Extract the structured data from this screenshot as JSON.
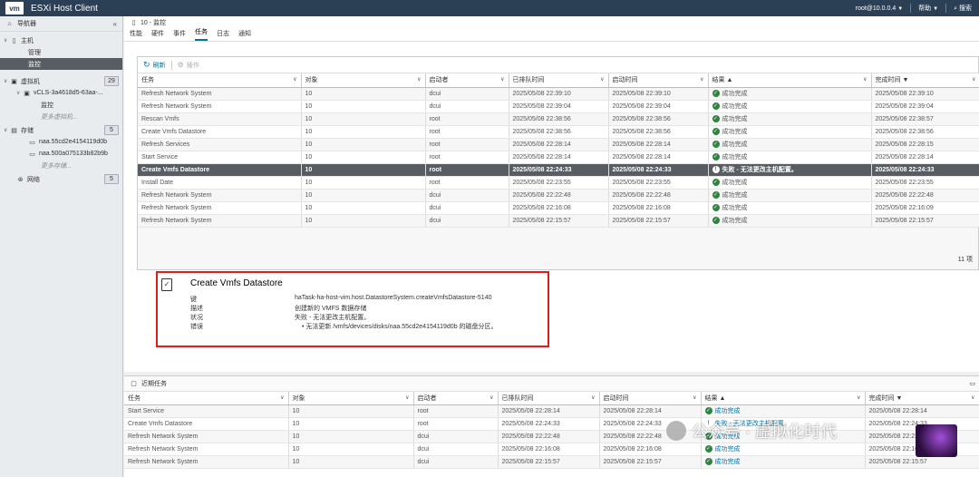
{
  "topbar": {
    "logo": "vm",
    "title": "ESXi Host Client",
    "user": "root@10.0.0.4",
    "help": "帮助",
    "search": "搜索",
    "bg": "#2b3f55"
  },
  "sidebar": {
    "header": "导航器",
    "host": "主机",
    "manage": "管理",
    "monitor": "监控",
    "vms": "虚拟机",
    "vms_count": "29",
    "vm1": "vCLS-3a4618d5-63aa-...",
    "vm1_monitor": "监控",
    "more_vms": "更多虚拟机...",
    "storage": "存储",
    "storage_count": "5",
    "ds1": "naa.55cd2e4154119d0b",
    "ds2": "naa.500a075133b82b9b",
    "more_storage": "更多存储...",
    "network": "网络",
    "network_count": "5"
  },
  "main": {
    "breadcrumb": "10 - 监控",
    "tabs": [
      "性能",
      "硬件",
      "事件",
      "任务",
      "日志",
      "通知"
    ],
    "active_tab": "任务",
    "toolbar": {
      "refresh": "刷新",
      "actions": "操作"
    },
    "columns": [
      "任务",
      "对象",
      "启动者",
      "已排队时间",
      "启动时间",
      "结果 ▲",
      "完成时间 ▼"
    ],
    "rows": [
      {
        "task": "Refresh Network System",
        "obj": "10",
        "by": "dcui",
        "queued": "2025/05/08 22:39:10",
        "started": "2025/05/08 22:39:10",
        "result": "成功完成",
        "done": "2025/05/08 22:39:10"
      },
      {
        "task": "Refresh Network System",
        "obj": "10",
        "by": "dcui",
        "queued": "2025/05/08 22:39:04",
        "started": "2025/05/08 22:39:04",
        "result": "成功完成",
        "done": "2025/05/08 22:39:04"
      },
      {
        "task": "Rescan Vmfs",
        "obj": "10",
        "by": "root",
        "queued": "2025/05/08 22:38:56",
        "started": "2025/05/08 22:38:56",
        "result": "成功完成",
        "done": "2025/05/08 22:38:57"
      },
      {
        "task": "Create Vmfs Datastore",
        "obj": "10",
        "by": "root",
        "queued": "2025/05/08 22:38:56",
        "started": "2025/05/08 22:38:56",
        "result": "成功完成",
        "done": "2025/05/08 22:38:56"
      },
      {
        "task": "Refresh Services",
        "obj": "10",
        "by": "root",
        "queued": "2025/05/08 22:28:14",
        "started": "2025/05/08 22:28:14",
        "result": "成功完成",
        "done": "2025/05/08 22:28:15"
      },
      {
        "task": "Start Service",
        "obj": "10",
        "by": "root",
        "queued": "2025/05/08 22:28:14",
        "started": "2025/05/08 22:28:14",
        "result": "成功完成",
        "done": "2025/05/08 22:28:14"
      },
      {
        "task": "Create Vmfs Datastore",
        "obj": "10",
        "by": "root",
        "queued": "2025/05/08 22:24:33",
        "started": "2025/05/08 22:24:33",
        "result": "失败 - 无法更改主机配置。",
        "done": "2025/05/08 22:24:33"
      },
      {
        "task": "Install Date",
        "obj": "10",
        "by": "root",
        "queued": "2025/05/08 22:23:55",
        "started": "2025/05/08 22:23:55",
        "result": "成功完成",
        "done": "2025/05/08 22:23:55"
      },
      {
        "task": "Refresh Network System",
        "obj": "10",
        "by": "dcui",
        "queued": "2025/05/08 22:22:48",
        "started": "2025/05/08 22:22:48",
        "result": "成功完成",
        "done": "2025/05/08 22:22:48"
      },
      {
        "task": "Refresh Network System",
        "obj": "10",
        "by": "dcui",
        "queued": "2025/05/08 22:16:08",
        "started": "2025/05/08 22:16:08",
        "result": "成功完成",
        "done": "2025/05/08 22:16:09"
      },
      {
        "task": "Refresh Network System",
        "obj": "10",
        "by": "dcui",
        "queued": "2025/05/08 22:15:57",
        "started": "2025/05/08 22:15:57",
        "result": "成功完成",
        "done": "2025/05/08 22:15:57"
      }
    ],
    "count": "11 项"
  },
  "detail": {
    "title": "Create Vmfs Datastore",
    "rows": [
      {
        "key": "键",
        "val": "haTask-ha-host-vim.host.DatastoreSystem.createVmfsDatastore-5140"
      },
      {
        "key": "描述",
        "val": "创建新的 VMFS 数据存储"
      },
      {
        "key": "状况",
        "val": "失败 - 无法更改主机配置。"
      },
      {
        "key": "错误",
        "val": ""
      }
    ],
    "error_bullet": "无法更新 /vmfs/devices/disks/naa.55cd2e4154119d0b 的磁盘分区。",
    "border_color": "#e01c1c"
  },
  "recent": {
    "title": "近期任务",
    "columns": [
      "任务",
      "对象",
      "启动者",
      "已排队时间",
      "启动时间",
      "结果 ▲",
      "完成时间 ▼"
    ],
    "rows": [
      {
        "task": "Start Service",
        "obj": "10",
        "by": "root",
        "queued": "2025/05/08 22:28:14",
        "started": "2025/05/08 22:28:14",
        "result": "成功完成",
        "done": "2025/05/08 22:28:14"
      },
      {
        "task": "Create Vmfs Datastore",
        "obj": "10",
        "by": "root",
        "queued": "2025/05/08 22:24:33",
        "started": "2025/05/08 22:24:33",
        "result": "失败 - 无法更改主机配置。",
        "done": "2025/05/08 22:24:33"
      },
      {
        "task": "Refresh Network System",
        "obj": "10",
        "by": "dcui",
        "queued": "2025/05/08 22:22:48",
        "started": "2025/05/08 22:22:48",
        "result": "成功完成",
        "done": "2025/05/08 22:22:48"
      },
      {
        "task": "Refresh Network System",
        "obj": "10",
        "by": "dcui",
        "queued": "2025/05/08 22:16:08",
        "started": "2025/05/08 22:16:08",
        "result": "成功完成",
        "done": "2025/05/08 22:16:09"
      },
      {
        "task": "Refresh Network System",
        "obj": "10",
        "by": "dcui",
        "queued": "2025/05/08 22:15:57",
        "started": "2025/05/08 22:15:57",
        "result": "成功完成",
        "done": "2025/05/08 22:15:57"
      }
    ]
  },
  "watermark": "公众号 · 虚拟化时代"
}
